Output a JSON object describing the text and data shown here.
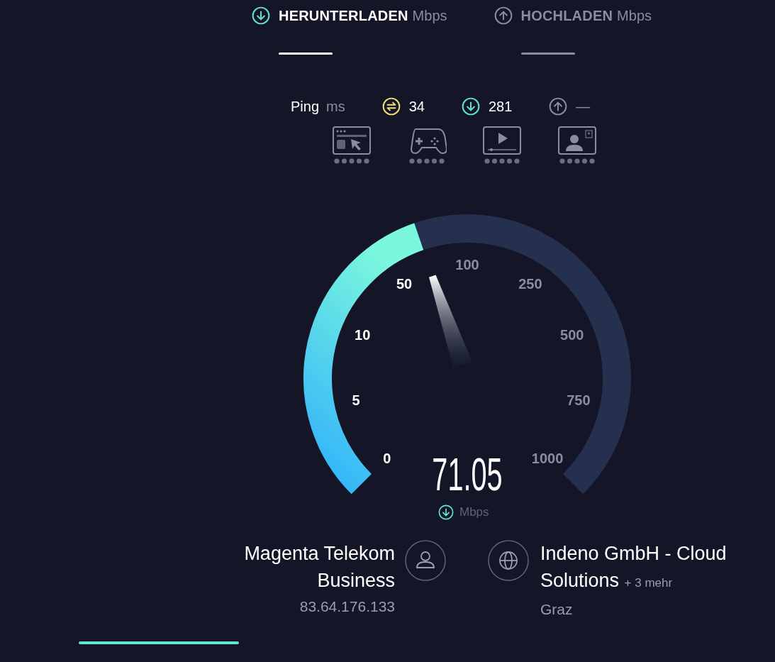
{
  "tabs": [
    {
      "kind": "download",
      "label": "HERUNTERLADEN",
      "unit": "Mbps",
      "selected": true
    },
    {
      "kind": "upload",
      "label": "HOCHLADEN",
      "unit": "Mbps",
      "selected": false
    }
  ],
  "ping": {
    "label": "Ping",
    "unit": "ms",
    "readings": [
      {
        "kind": "ping",
        "value": "34"
      },
      {
        "kind": "download",
        "value": "281"
      },
      {
        "kind": "upload",
        "value": "—"
      }
    ]
  },
  "activities": [
    {
      "kind": "browsing"
    },
    {
      "kind": "gaming"
    },
    {
      "kind": "video"
    },
    {
      "kind": "video_call"
    }
  ],
  "gauge": {
    "scale_labels": [
      "0",
      "5",
      "10",
      "50",
      "100",
      "250",
      "500",
      "750",
      "1000"
    ],
    "reading": "71.05",
    "unit": "Mbps"
  },
  "provider": {
    "name": "Magenta Telekom Business",
    "ip": "83.64.176.133"
  },
  "server": {
    "name": "Indeno GmbH - Cloud Solutions",
    "more": "+ 3 mehr",
    "location": "Graz"
  }
}
